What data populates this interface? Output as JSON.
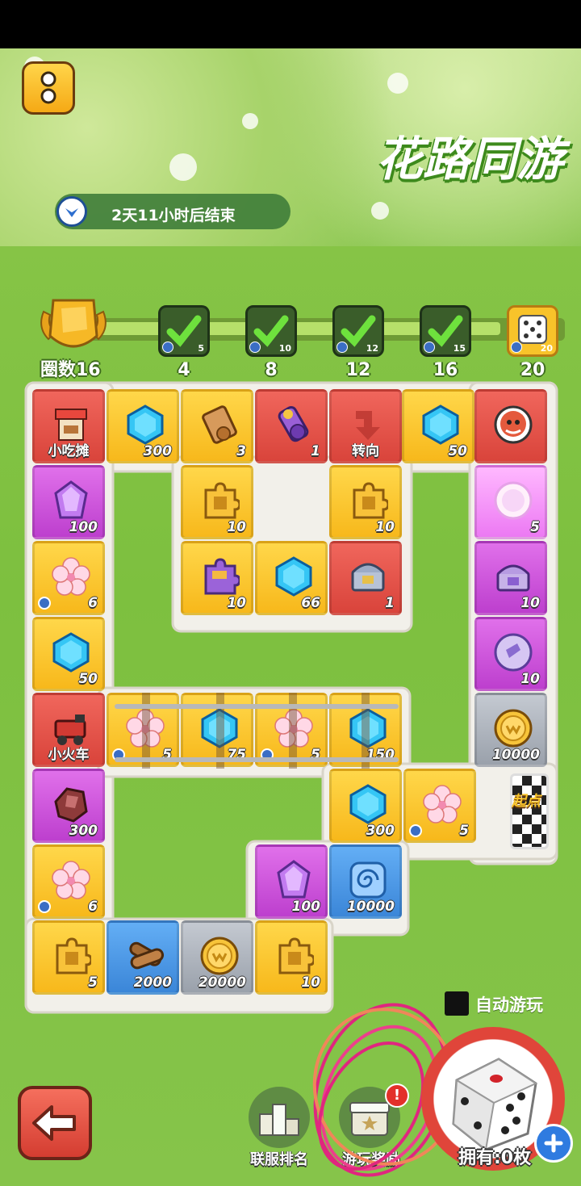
{
  "header": {
    "title": "花路同游",
    "timer_text": "2天11小时后结束"
  },
  "progress": {
    "laps_label": "圈数16",
    "milestones": [
      {
        "label": "4",
        "count": "5",
        "done": true
      },
      {
        "label": "8",
        "count": "10",
        "done": true
      },
      {
        "label": "12",
        "count": "12",
        "done": true
      },
      {
        "label": "16",
        "count": "15",
        "done": true
      },
      {
        "label": "20",
        "count": "20",
        "done": false
      }
    ]
  },
  "board": {
    "tiles": [
      {
        "name": "tile-snack-stand",
        "color": "red",
        "icon": "snack-stand-icon",
        "label": "小吃摊"
      },
      {
        "name": "tile-gem-300",
        "color": "yellow",
        "icon": "gem-icon",
        "value": "300"
      },
      {
        "name": "tile-scroll-3",
        "color": "yellow",
        "icon": "scroll-icon",
        "value": "3"
      },
      {
        "name": "tile-purple-scroll-1",
        "color": "red",
        "icon": "purple-scroll-icon",
        "value": "1"
      },
      {
        "name": "tile-turn",
        "color": "red",
        "icon": "turn-arrow-icon",
        "label": "转向"
      },
      {
        "name": "tile-gem-50-top",
        "color": "yellow",
        "icon": "gem-icon",
        "value": "50"
      },
      {
        "name": "tile-player",
        "color": "red",
        "icon": "player-avatar-icon"
      },
      {
        "name": "tile-purple-crystal-100",
        "color": "purple",
        "icon": "purple-crystal-icon",
        "value": "100"
      },
      {
        "name": "tile-puzzle-10-a",
        "color": "yellow",
        "icon": "puzzle-icon",
        "value": "10"
      },
      {
        "name": "tile-puzzle-10-b",
        "color": "yellow",
        "icon": "puzzle-icon",
        "value": "10"
      },
      {
        "name": "tile-pink-coin-5",
        "color": "pink",
        "icon": "pink-coin-icon",
        "value": "5"
      },
      {
        "name": "tile-flower-6-a",
        "color": "yellow",
        "icon": "flower-icon",
        "value": "6"
      },
      {
        "name": "tile-purple-puzzle-10",
        "color": "yellow",
        "icon": "purple-puzzle-icon",
        "value": "10"
      },
      {
        "name": "tile-gem-66",
        "color": "yellow",
        "icon": "gem-icon",
        "value": "66"
      },
      {
        "name": "tile-chest-1",
        "color": "red",
        "icon": "chest-icon",
        "value": "1"
      },
      {
        "name": "tile-purple-chest-10",
        "color": "purple",
        "icon": "purple-chest-icon",
        "value": "10"
      },
      {
        "name": "tile-gem-50-left",
        "color": "yellow",
        "icon": "gem-icon",
        "value": "50"
      },
      {
        "name": "tile-purple-coin-10",
        "color": "purple",
        "icon": "purple-coin-icon",
        "value": "10"
      },
      {
        "name": "tile-train",
        "color": "red",
        "icon": "train-icon",
        "label": "小火车"
      },
      {
        "name": "tile-train-flower-5-a",
        "color": "yellow",
        "icon": "flower-icon",
        "value": "5"
      },
      {
        "name": "tile-train-gem-75",
        "color": "yellow",
        "icon": "gem-icon",
        "value": "75"
      },
      {
        "name": "tile-train-flower-5-b",
        "color": "yellow",
        "icon": "flower-icon",
        "value": "5"
      },
      {
        "name": "tile-train-gem-150",
        "color": "yellow",
        "icon": "gem-icon",
        "value": "150"
      },
      {
        "name": "tile-gold-coin-10000",
        "color": "gray",
        "icon": "gold-coin-icon",
        "value": "10000"
      },
      {
        "name": "tile-ore-300",
        "color": "purple",
        "icon": "ore-icon",
        "value": "300"
      },
      {
        "name": "tile-gem-300-b",
        "color": "yellow",
        "icon": "gem-icon",
        "value": "300"
      },
      {
        "name": "tile-flower-5-start",
        "color": "yellow",
        "icon": "flower-icon",
        "value": "5"
      },
      {
        "name": "tile-flower-6-b",
        "color": "yellow",
        "icon": "flower-icon",
        "value": "6"
      },
      {
        "name": "tile-purple-crystal-100-b",
        "color": "purple",
        "icon": "purple-crystal-icon",
        "value": "100"
      },
      {
        "name": "tile-spiral-10000",
        "color": "blue",
        "icon": "spiral-icon",
        "value": "10000"
      },
      {
        "name": "tile-puzzle-5",
        "color": "yellow",
        "icon": "puzzle-icon",
        "value": "5"
      },
      {
        "name": "tile-wood-2000",
        "color": "blue",
        "icon": "wood-icon",
        "value": "2000"
      },
      {
        "name": "tile-gold-coin-20000",
        "color": "gray",
        "icon": "gold-coin-icon",
        "value": "20000"
      },
      {
        "name": "tile-puzzle-10-c",
        "color": "yellow",
        "icon": "puzzle-icon",
        "value": "10"
      }
    ],
    "start_label": "起点"
  },
  "controls": {
    "auto_play": "自动游玩",
    "leaderboard": "联服排名",
    "rewards": "游玩奖励",
    "rewards_badge": "!",
    "owned": "拥有:0枚"
  },
  "colors": {
    "yellow": "#f7b81b",
    "red": "#d9443b",
    "purple": "#bd3fce",
    "blue": "#3b86d8",
    "gray": "#9aa1ab",
    "pink": "#ec79f3",
    "accent_green": "#3d8a1c"
  }
}
